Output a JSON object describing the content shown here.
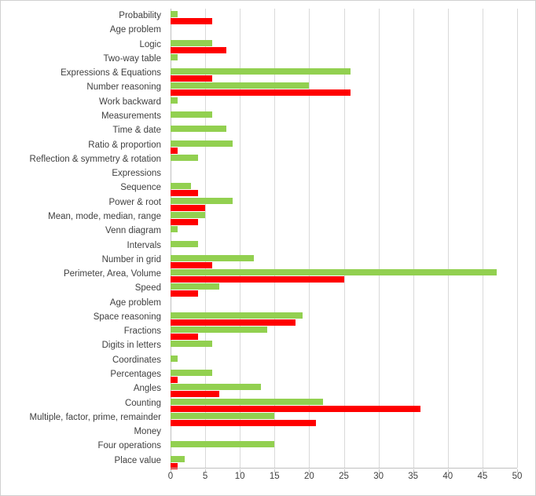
{
  "chart_data": {
    "type": "bar",
    "orientation": "horizontal",
    "title": "",
    "subtitle": "",
    "xlabel": "",
    "ylabel": "",
    "xlim": [
      0,
      50
    ],
    "xticks": [
      0,
      5,
      10,
      15,
      20,
      25,
      30,
      35,
      40,
      45,
      50
    ],
    "grid": true,
    "legend": "none",
    "colors": {
      "series_green": "#92D050",
      "series_red": "#FF0000",
      "gridline": "#d9d9d9",
      "axis": "#bfbfbf",
      "text": "#404040",
      "border": "#d0d0d0",
      "background": "#ffffff"
    },
    "categories": [
      "Probability",
      "Age problem",
      "Logic",
      "Two-way table",
      "Expressions & Equations",
      "Number reasoning",
      "Work backward",
      "Measurements",
      "Time & date",
      "Ratio & proportion",
      "Reflection & symmetry & rotation",
      "Expressions",
      "Sequence",
      "Power & root",
      "Mean, mode, median, range",
      "Venn diagram",
      "Intervals",
      "Number in grid",
      "Perimeter, Area, Volume",
      "Speed",
      "Age problem",
      "Space reasoning",
      "Fractions",
      "Digits in letters",
      "Coordinates",
      "Percentages",
      "Angles",
      "Counting",
      "Multiple, factor, prime, remainder",
      "Money",
      "Four operations",
      "Place value"
    ],
    "series": [
      {
        "name": "series_green",
        "color": "#92D050",
        "values": [
          1,
          0,
          6,
          1,
          26,
          20,
          1,
          6,
          8,
          9,
          4,
          0,
          3,
          9,
          5,
          1,
          4,
          12,
          47,
          7,
          0,
          19,
          14,
          6,
          1,
          6,
          13,
          22,
          15,
          0,
          15,
          2
        ]
      },
      {
        "name": "series_red",
        "color": "#FF0000",
        "values": [
          6,
          0,
          8,
          0,
          6,
          26,
          0,
          0,
          0,
          1,
          0,
          0,
          4,
          5,
          4,
          0,
          0,
          6,
          25,
          4,
          0,
          18,
          4,
          0,
          0,
          1,
          7,
          36,
          21,
          0,
          0,
          1
        ]
      }
    ]
  }
}
